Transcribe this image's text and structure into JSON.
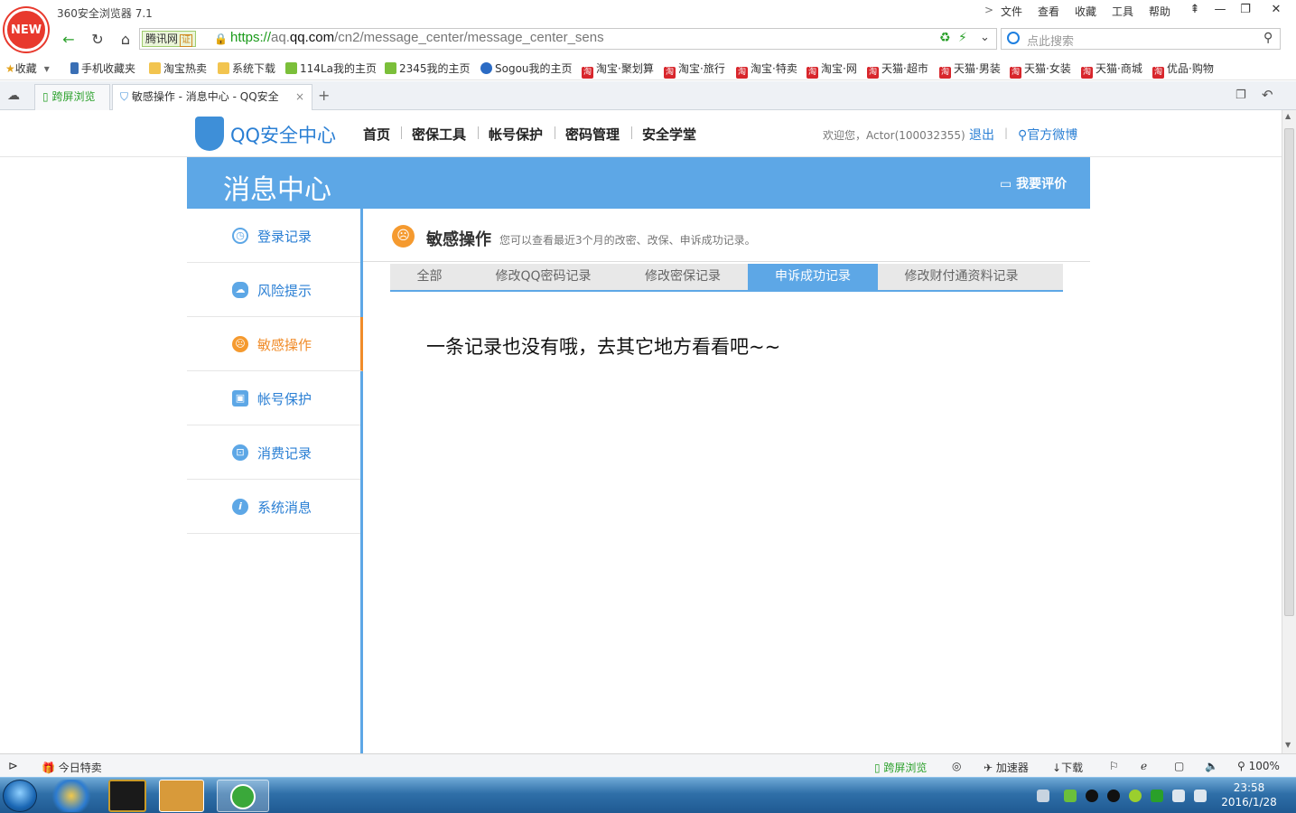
{
  "browser": {
    "title": "360安全浏览器 7.1",
    "new_badge": "NEW",
    "menu": [
      "文件",
      "查看",
      "收藏",
      "工具",
      "帮助"
    ],
    "address": {
      "site_label": "腾讯网",
      "cert_label": "证",
      "url_proto": "https://",
      "url_pre": "aq.",
      "url_host": "qq.com",
      "url_path": "/cn2/message_center/message_center_sens"
    },
    "search_placeholder": "点此搜索"
  },
  "bookmarks": [
    {
      "label": "收藏",
      "icon": "star-icon"
    },
    {
      "label": "手机收藏夹",
      "icon": "phone-icon"
    },
    {
      "label": "淘宝热卖",
      "icon": "folder-icon"
    },
    {
      "label": "系统下载",
      "icon": "folder-icon"
    },
    {
      "label": "114La我的主页",
      "icon": "house-icon"
    },
    {
      "label": "2345我的主页",
      "icon": "house-icon"
    },
    {
      "label": "Sogou我的主页",
      "icon": "sogou-icon"
    },
    {
      "label": "淘宝·聚划算",
      "icon": "taobao-icon"
    },
    {
      "label": "淘宝·旅行",
      "icon": "taobao-icon"
    },
    {
      "label": "淘宝·特卖",
      "icon": "taobao-icon"
    },
    {
      "label": "淘宝·网",
      "icon": "taobao-icon"
    },
    {
      "label": "天猫·超市",
      "icon": "taobao-icon"
    },
    {
      "label": "天猫·男装",
      "icon": "taobao-icon"
    },
    {
      "label": "天猫·女装",
      "icon": "taobao-icon"
    },
    {
      "label": "天猫·商城",
      "icon": "taobao-icon"
    },
    {
      "label": "优品·购物",
      "icon": "taobao-icon"
    }
  ],
  "bookmark_icon_text": "淘",
  "tabs": [
    {
      "label": "跨屏浏览"
    },
    {
      "label": "敏感操作 - 消息中心 - QQ安全"
    }
  ],
  "site": {
    "logo_text": "QQ安全中心",
    "nav": [
      "首页",
      "密保工具",
      "帐号保护",
      "密码管理",
      "安全学堂"
    ],
    "welcome": "欢迎您，Actor(100032355)",
    "logout": "退出",
    "weibo": "官方微博",
    "banner_title": "消息中心",
    "rate_label": "我要评价"
  },
  "sidebar": {
    "items": [
      {
        "label": "登录记录",
        "icon": "clock-icon"
      },
      {
        "label": "风险提示",
        "icon": "cloud-icon"
      },
      {
        "label": "敏感操作",
        "icon": "sad-face-icon"
      },
      {
        "label": "帐号保护",
        "icon": "lock-icon"
      },
      {
        "label": "消费记录",
        "icon": "cart-icon"
      },
      {
        "label": "系统消息",
        "icon": "info-icon"
      }
    ],
    "active_index": 2
  },
  "content": {
    "title": "敏感操作",
    "subtitle": "您可以查看最近3个月的改密、改保、申诉成功记录。",
    "tabs": [
      "全部",
      "修改QQ密码记录",
      "修改密保记录",
      "申诉成功记录",
      "修改财付通资料记录"
    ],
    "active_tab": 3,
    "empty_message": "一条记录也没有哦，去其它地方看看吧~~"
  },
  "statusbar": {
    "left": "今日特卖",
    "cross_screen": "跨屏浏览",
    "accelerator": "加速器",
    "download": "下载",
    "zoom": "100%"
  },
  "taskbar": {
    "time": "23:58",
    "date": "2016/1/28"
  },
  "colors": {
    "accent_blue": "#5da7e6",
    "link_blue": "#2a7fd4",
    "active_orange": "#f08c2a"
  }
}
